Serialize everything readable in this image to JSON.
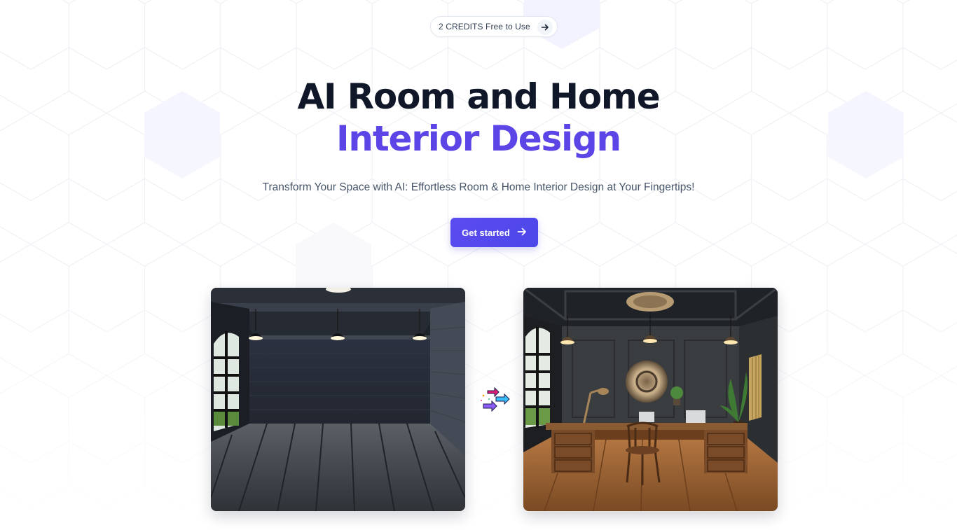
{
  "banner": {
    "credits_label": "2 CREDITS Free to Use",
    "arrow_icon": "arrow-right-icon"
  },
  "hero": {
    "title_line1": "AI Room and Home",
    "title_line2": "Interior Design",
    "subtitle": "Transform Your Space with AI: Effortless Room & Home Interior Design at Your Fingertips!",
    "cta_label": "Get started",
    "cta_icon": "arrow-right-icon"
  },
  "showcase": {
    "before_image": "empty-dark-room-image",
    "transform_icon": "transform-arrows-icon",
    "after_image": "furnished-office-room-image"
  },
  "colors": {
    "accent": "#5b45e6",
    "heading": "#0f1729",
    "cta_bg": "#4f46e5"
  }
}
